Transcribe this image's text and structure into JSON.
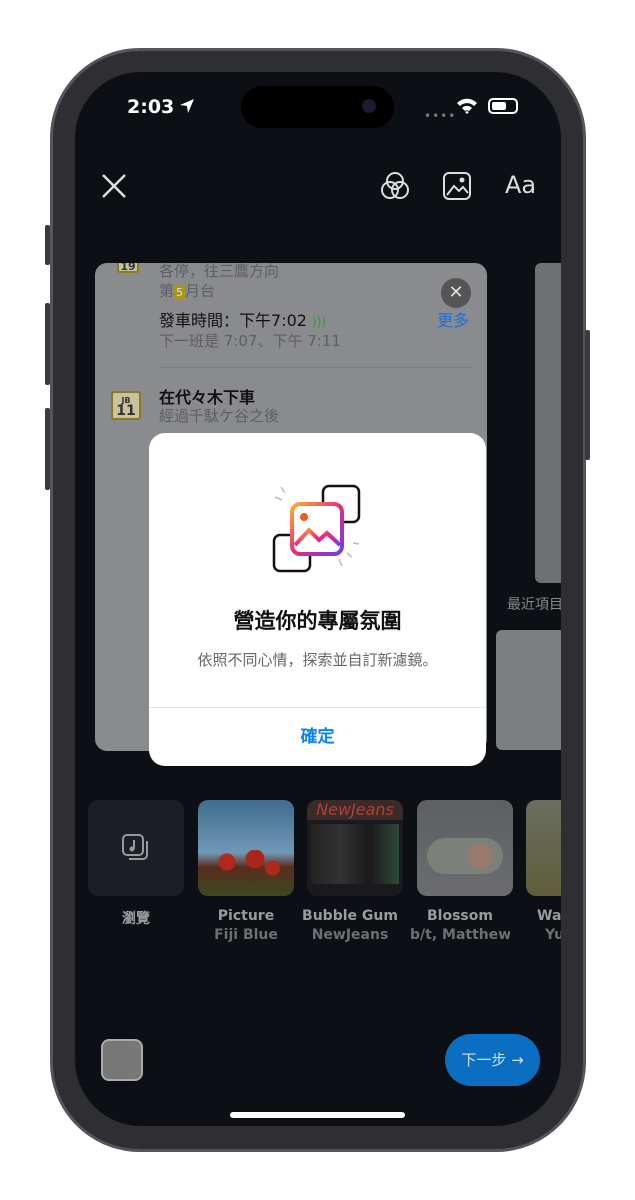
{
  "status_bar": {
    "time": "2:03"
  },
  "toolbar": {
    "close": "close",
    "icons": [
      "filter-icon",
      "image-icon",
      "text-icon"
    ],
    "text_label": "Aa"
  },
  "background_card": {
    "line1": "各停，往三鷹方向",
    "platform_prefix": "第",
    "platform_number": "5",
    "platform_suffix": "月台",
    "departure": "發車時間：下午7:02",
    "next": "下一班是 7:07、下午 7:11",
    "more": "更多",
    "badge_top": "19",
    "stop_title": "在代々木下車",
    "stop_sub": "經過千駄ケ谷之後",
    "badge_line": "JB",
    "badge_num": "11"
  },
  "side_label": "最近項目",
  "dialog": {
    "title": "營造你的專屬氛圍",
    "message": "依照不同心情，探索並自訂新濾鏡。",
    "confirm": "確定"
  },
  "music": {
    "browse_label": "瀏覽",
    "items": [
      {
        "title": "Picture",
        "artist": "Fiji Blue"
      },
      {
        "title": "Bubble Gum",
        "artist": "NewJeans",
        "cover_text": "NewJeans"
      },
      {
        "title": "Blossom",
        "artist": "b/t, Matthew"
      },
      {
        "title": "Wa",
        "artist": "Yu"
      }
    ]
  },
  "next_button": "下一步 →",
  "colors": {
    "accent": "#0a84ff",
    "next_bg": "#0a6fc2"
  }
}
